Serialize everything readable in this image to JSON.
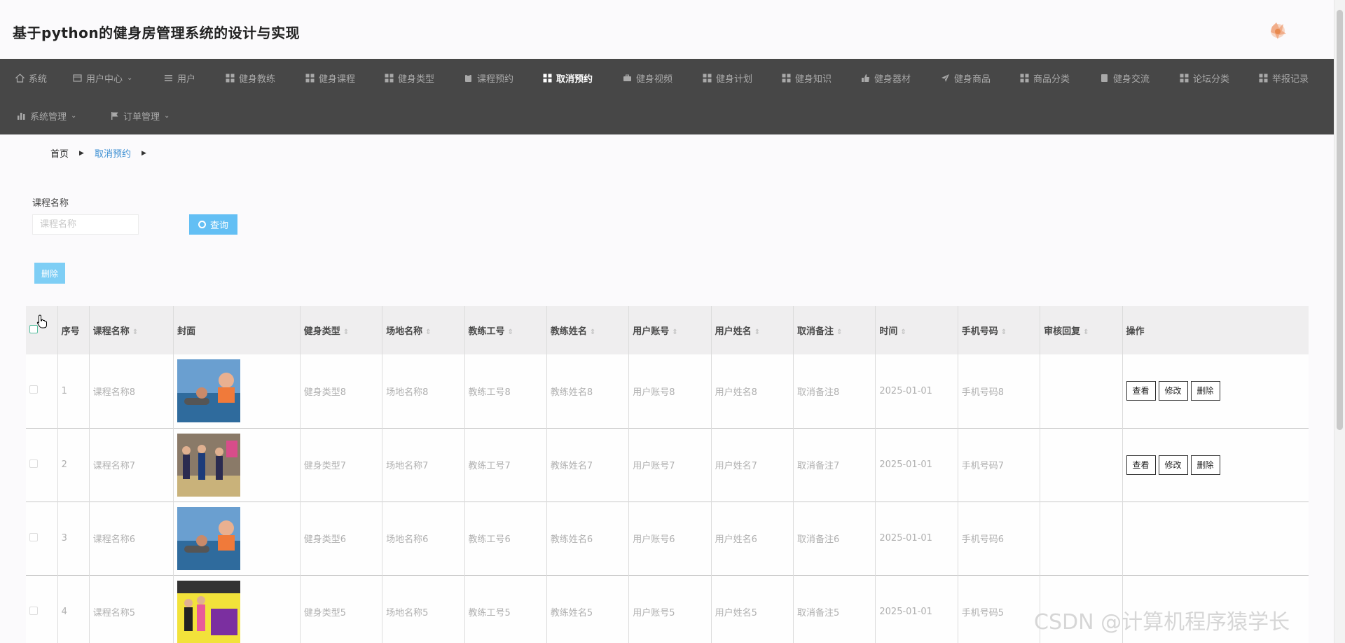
{
  "header": {
    "title": "基于python的健身房管理系统的设计与实现"
  },
  "nav": {
    "row1": [
      {
        "label": "系统",
        "icon": "home-icon"
      },
      {
        "label": "用户中心",
        "icon": "user-card-icon",
        "dropdown": true
      },
      {
        "label": "用户",
        "icon": "list-icon"
      },
      {
        "label": "健身教练",
        "icon": "grid-icon"
      },
      {
        "label": "健身课程",
        "icon": "grid-icon"
      },
      {
        "label": "健身类型",
        "icon": "grid-icon"
      },
      {
        "label": "课程预约",
        "icon": "clipboard-icon"
      },
      {
        "label": "取消预约",
        "icon": "grid-icon",
        "active": true
      },
      {
        "label": "健身视频",
        "icon": "briefcase-icon"
      },
      {
        "label": "健身计划",
        "icon": "grid-icon"
      },
      {
        "label": "健身知识",
        "icon": "grid-icon"
      },
      {
        "label": "健身器材",
        "icon": "thumbs-up-icon"
      },
      {
        "label": "健身商品",
        "icon": "send-icon"
      },
      {
        "label": "商品分类",
        "icon": "grid-icon"
      },
      {
        "label": "健身交流",
        "icon": "tablet-icon"
      },
      {
        "label": "论坛分类",
        "icon": "grid-icon"
      },
      {
        "label": "举报记录",
        "icon": "grid-icon"
      }
    ],
    "row2": [
      {
        "label": "系统管理",
        "icon": "bar-chart-icon",
        "dropdown": true
      },
      {
        "label": "订单管理",
        "icon": "flag-icon",
        "dropdown": true
      }
    ]
  },
  "breadcrumb": {
    "home": "首页",
    "current": "取消预约"
  },
  "search": {
    "label": "课程名称",
    "placeholder": "课程名称",
    "value": "",
    "button": "查询"
  },
  "actions": {
    "delete_batch": "删除"
  },
  "table": {
    "columns": [
      "序号",
      "课程名称",
      "封面",
      "健身类型",
      "场地名称",
      "教练工号",
      "教练姓名",
      "用户账号",
      "用户姓名",
      "取消备注",
      "时间",
      "手机号码",
      "审核回复",
      "操作"
    ],
    "sortable": [
      false,
      true,
      false,
      true,
      true,
      true,
      true,
      true,
      true,
      true,
      true,
      true,
      true,
      false
    ],
    "rows": [
      {
        "index": "1",
        "course": "课程名称8",
        "type": "健身类型8",
        "venue": "场地名称8",
        "coach_no": "教练工号8",
        "coach_name": "教练姓名8",
        "account": "用户账号8",
        "user_name": "用户姓名8",
        "remark": "取消备注8",
        "time": "2025-01-01",
        "phone": "手机号码8",
        "reply": "",
        "ops": [
          "查看",
          "修改",
          "删除"
        ]
      },
      {
        "index": "2",
        "course": "课程名称7",
        "type": "健身类型7",
        "venue": "场地名称7",
        "coach_no": "教练工号7",
        "coach_name": "教练姓名7",
        "account": "用户账号7",
        "user_name": "用户姓名7",
        "remark": "取消备注7",
        "time": "2025-01-01",
        "phone": "手机号码7",
        "reply": "",
        "ops": [
          "查看",
          "修改",
          "删除"
        ]
      },
      {
        "index": "3",
        "course": "课程名称6",
        "type": "健身类型6",
        "venue": "场地名称6",
        "coach_no": "教练工号6",
        "coach_name": "教练姓名6",
        "account": "用户账号6",
        "user_name": "用户姓名6",
        "remark": "取消备注6",
        "time": "2025-01-01",
        "phone": "手机号码6",
        "reply": "",
        "ops": []
      },
      {
        "index": "4",
        "course": "课程名称5",
        "type": "健身类型5",
        "venue": "场地名称5",
        "coach_no": "教练工号5",
        "coach_name": "教练姓名5",
        "account": "用户账号5",
        "user_name": "用户姓名5",
        "remark": "取消备注5",
        "time": "2025-01-01",
        "phone": "手机号码5",
        "reply": "",
        "ops": []
      }
    ]
  },
  "watermark": "CSDN @计算机程序猿学长"
}
